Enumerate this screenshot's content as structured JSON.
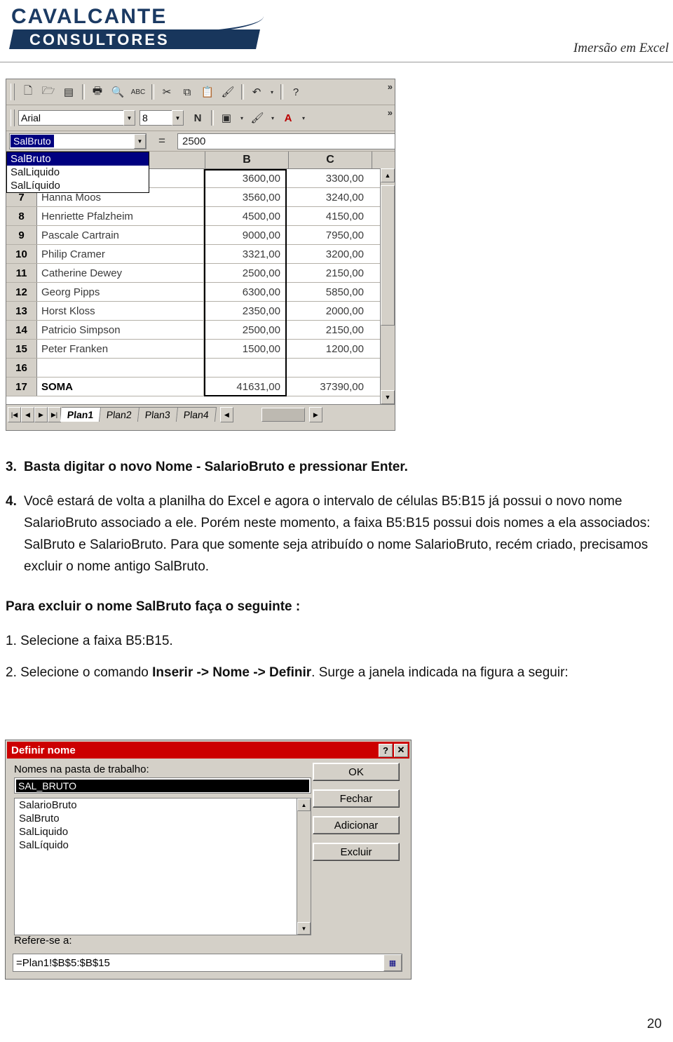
{
  "header": {
    "logo_top": "CAVALCANTE",
    "logo_bottom": "CONSULTORES",
    "title": "Imersão em Excel"
  },
  "excel": {
    "toolbar_icons": [
      "new-file-icon",
      "open-folder-icon",
      "save-icon",
      "print-icon",
      "print-preview-icon",
      "spellcheck-icon",
      "cut-icon",
      "copy-icon",
      "paste-icon",
      "format-painter-icon",
      "undo-icon",
      "help-icon"
    ],
    "font_name": "Arial",
    "font_size": "8",
    "bold_label": "N",
    "name_box_value": "SalBruto",
    "equals_sign": "=",
    "formula_value": "2500",
    "name_dropdown_items": [
      {
        "label": "SalBruto",
        "highlighted": true
      },
      {
        "label": "SalLiquido",
        "highlighted": false
      },
      {
        "label": "SalLíquido",
        "highlighted": false
      }
    ],
    "columns": [
      "",
      "B",
      "C"
    ],
    "rows": [
      {
        "num": "7",
        "a": "Hanna Moos",
        "b": "3560,00",
        "c": "3240,00"
      },
      {
        "num": "8",
        "a": "Henriette Pfalzheim",
        "b": "4500,00",
        "c": "4150,00"
      },
      {
        "num": "9",
        "a": "Pascale Cartrain",
        "b": "9000,00",
        "c": "7950,00"
      },
      {
        "num": "10",
        "a": "Philip Cramer",
        "b": "3321,00",
        "c": "3200,00"
      },
      {
        "num": "11",
        "a": "Catherine Dewey",
        "b": "2500,00",
        "c": "2150,00"
      },
      {
        "num": "12",
        "a": "Georg Pipps",
        "b": "6300,00",
        "c": "5850,00"
      },
      {
        "num": "13",
        "a": "Horst Kloss",
        "b": "2350,00",
        "c": "2000,00"
      },
      {
        "num": "14",
        "a": "Patricio Simpson",
        "b": "2500,00",
        "c": "2150,00"
      },
      {
        "num": "15",
        "a": "Peter Franken",
        "b": "1500,00",
        "c": "1200,00"
      },
      {
        "num": "16",
        "a": "",
        "b": "",
        "c": ""
      },
      {
        "num": "17",
        "a": "SOMA",
        "b": "41631,00",
        "c": "37390,00"
      }
    ],
    "hidden_top_row": {
      "b": "3600,00",
      "c": "3300,00"
    },
    "sheet_tabs": [
      "Plan1",
      "Plan2",
      "Plan3",
      "Plan4"
    ],
    "active_tab": "Plan1"
  },
  "body": {
    "items": [
      {
        "num": "3.",
        "html": "Basta digitar o novo Nome - <b>SalarioBruto</b> e pressionar Enter.",
        "bold_all": true
      },
      {
        "num": "4.",
        "html": "Você estará de volta a planilha do Excel e agora o intervalo de células B5:B15 já possui o novo nome SalarioBruto associado a ele. Porém neste momento, a faixa B5:B15 possui dois nomes a ela associados: SalBruto e SalarioBruto. Para que somente seja atribuído o nome SalarioBruto, recém criado, precisamos excluir o nome antigo SalBruto."
      }
    ],
    "heading": "Para excluir o nome SalBruto faça o seguinte :",
    "step1": "1. Selecione a faixa B5:B15.",
    "step2_prefix": "2. Selecione o comando ",
    "step2_bold": "Inserir -> Nome -> Definir",
    "step2_suffix": ". Surge a janela indicada na figura a seguir:"
  },
  "dialog": {
    "title": "Definir nome",
    "help_button": "?",
    "close_button": "✕",
    "label_names": "Nomes na pasta de trabalho:",
    "input_value": "SAL_BRUTO",
    "list_items": [
      "SalarioBruto",
      "SalBruto",
      "SalLiquido",
      "SalLíquido"
    ],
    "buttons": [
      "OK",
      "Fechar",
      "Adicionar",
      "Excluir"
    ],
    "refers_label": "Refere-se a:",
    "refers_value": "=Plan1!$B$5:$B$15",
    "collapse_icon": "range-picker-icon"
  },
  "footer": {
    "page_number": "20"
  }
}
